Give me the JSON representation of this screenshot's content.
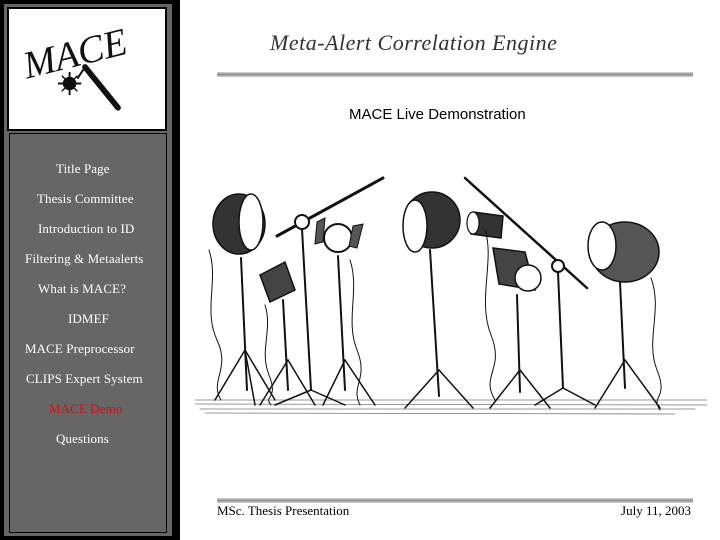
{
  "logo": {
    "text": "MACE",
    "icon": "mace-weapon-icon"
  },
  "header": {
    "title": "Meta-Alert Correlation Engine"
  },
  "slide": {
    "title": "MACE Live Demonstration",
    "image": "studio-spotlights-sketch"
  },
  "nav": {
    "items": [
      {
        "label": "Title Page",
        "active": false
      },
      {
        "label": "Thesis Committee",
        "active": false
      },
      {
        "label": "Introduction to ID",
        "active": false
      },
      {
        "label": "Filtering & Metaalerts",
        "active": false
      },
      {
        "label": "What is MACE?",
        "active": false
      },
      {
        "label": "IDMEF",
        "active": false
      },
      {
        "label": "MACE Preprocessor",
        "active": false
      },
      {
        "label": "CLIPS Expert System",
        "active": false
      },
      {
        "label": "MACE Demo",
        "active": true
      },
      {
        "label": "Questions",
        "active": false
      }
    ]
  },
  "footer": {
    "left": "MSc. Thesis Presentation",
    "right": "July 11, 2003"
  },
  "colors": {
    "panel": "#666666",
    "active_nav": "#cc1111",
    "nav_text": "#ffffff"
  }
}
